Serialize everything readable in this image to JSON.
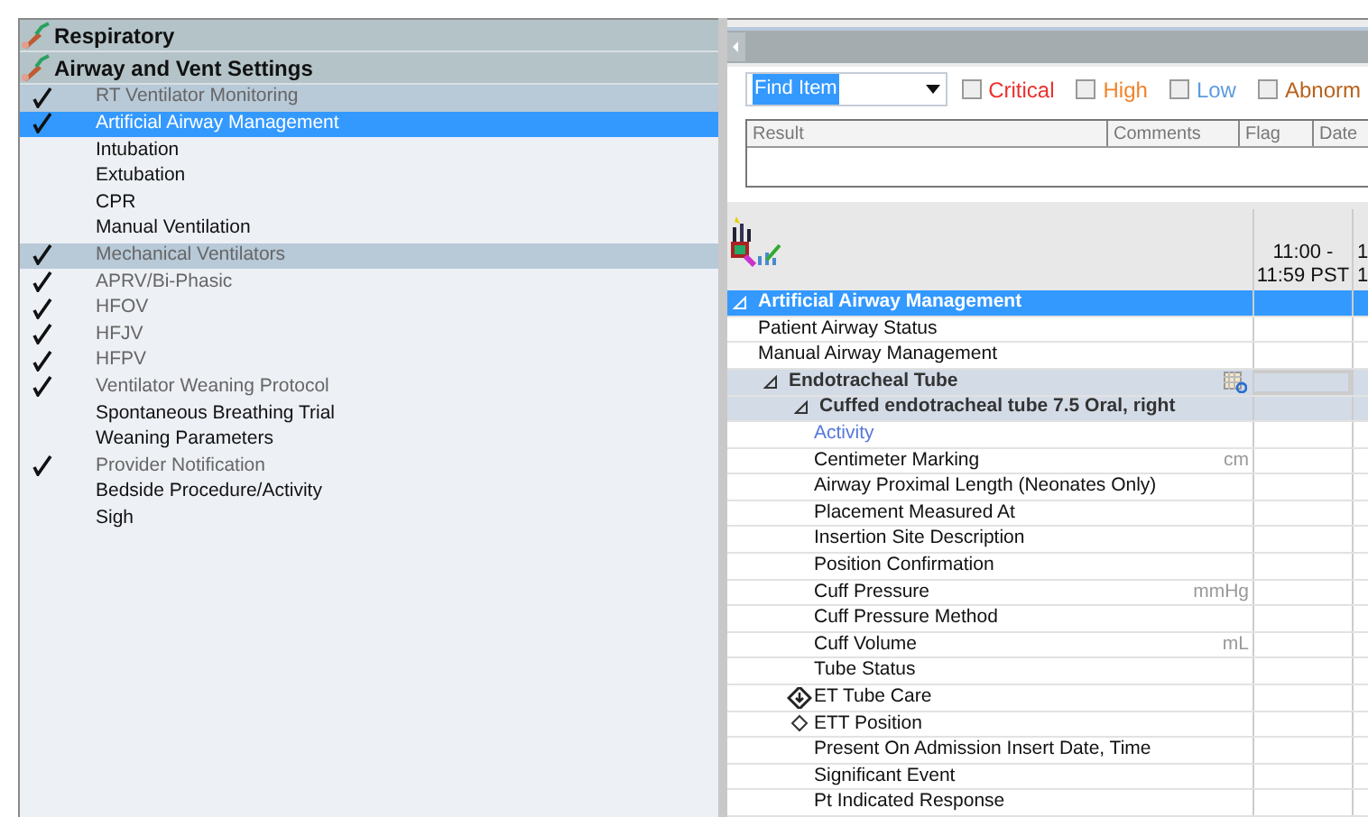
{
  "navigator": {
    "sections": [
      {
        "title": "Respiratory"
      },
      {
        "title": "Airway and Vent Settings"
      }
    ],
    "items": [
      {
        "label": "RT Ventilator Monitoring",
        "kind": "section",
        "checked": true,
        "selected": false
      },
      {
        "label": "Artificial Airway Management",
        "kind": "item",
        "checked": true,
        "selected": true
      },
      {
        "label": "Intubation",
        "kind": "item",
        "checked": false,
        "selected": false
      },
      {
        "label": "Extubation",
        "kind": "item",
        "checked": false,
        "selected": false
      },
      {
        "label": "CPR",
        "kind": "item",
        "checked": false,
        "selected": false
      },
      {
        "label": "Manual Ventilation",
        "kind": "item",
        "checked": false,
        "selected": false
      },
      {
        "label": "Mechanical Ventilators",
        "kind": "section",
        "checked": true,
        "selected": false
      },
      {
        "label": "APRV/Bi-Phasic",
        "kind": "item",
        "checked": true,
        "selected": false
      },
      {
        "label": "HFOV",
        "kind": "item",
        "checked": true,
        "selected": false
      },
      {
        "label": "HFJV",
        "kind": "item",
        "checked": true,
        "selected": false
      },
      {
        "label": "HFPV",
        "kind": "item",
        "checked": true,
        "selected": false
      },
      {
        "label": "Ventilator Weaning Protocol",
        "kind": "item",
        "checked": true,
        "selected": false
      },
      {
        "label": "Spontaneous Breathing Trial",
        "kind": "item",
        "checked": false,
        "selected": false
      },
      {
        "label": "Weaning Parameters",
        "kind": "item",
        "checked": false,
        "selected": false
      },
      {
        "label": "Provider Notification",
        "kind": "item",
        "checked": true,
        "selected": false
      },
      {
        "label": "Bedside Procedure/Activity",
        "kind": "item",
        "checked": false,
        "selected": false
      },
      {
        "label": "Sigh",
        "kind": "item",
        "checked": false,
        "selected": false
      }
    ]
  },
  "filter": {
    "find": {
      "value": "Find Item"
    },
    "flags": [
      {
        "label": "Critical",
        "checked": false,
        "color": "#e8322f"
      },
      {
        "label": "High",
        "checked": false,
        "color": "#f0832a"
      },
      {
        "label": "Low",
        "checked": false,
        "color": "#5b9be0"
      },
      {
        "label": "Abnorm",
        "checked": false,
        "color": "#b8621c"
      }
    ]
  },
  "results_table": {
    "columns": [
      "Result",
      "Comments",
      "Flag",
      "Date"
    ]
  },
  "flowsheet": {
    "columns": [
      {
        "line_1": "11:00 -",
        "line_2": "11:59 PST"
      },
      {
        "line_1": "1",
        "line_2": "1"
      }
    ],
    "rows": [
      {
        "label": "Artificial Airway Management",
        "kind": "header",
        "selected": true,
        "expanded": true,
        "children": [
          {
            "label": "Patient Airway Status",
            "kind": "field"
          },
          {
            "label": "Manual Airway Management",
            "kind": "field"
          },
          {
            "label": "Endotracheal Tube",
            "kind": "group",
            "expanded": true,
            "focused": true,
            "children": [
              {
                "label": "Cuffed endotracheal tube 7.5 Oral, right",
                "kind": "group",
                "expanded": true,
                "children": [
                  {
                    "label": "Activity",
                    "kind": "link"
                  },
                  {
                    "label": "Centimeter Marking",
                    "kind": "field",
                    "unit": "cm"
                  },
                  {
                    "label": "Airway Proximal Length (Neonates Only)",
                    "kind": "field"
                  },
                  {
                    "label": "Placement Measured At",
                    "kind": "field"
                  },
                  {
                    "label": "Insertion Site Description",
                    "kind": "field"
                  },
                  {
                    "label": "Position Confirmation",
                    "kind": "field"
                  },
                  {
                    "label": "Cuff Pressure",
                    "kind": "field",
                    "unit": "mmHg"
                  },
                  {
                    "label": "Cuff Pressure Method",
                    "kind": "field"
                  },
                  {
                    "label": "Cuff Volume",
                    "kind": "field",
                    "unit": "mL"
                  },
                  {
                    "label": "Tube Status",
                    "kind": "field"
                  },
                  {
                    "label": "ET Tube Care",
                    "kind": "form"
                  },
                  {
                    "label": "ETT Position",
                    "kind": "subform"
                  },
                  {
                    "label": "Present On Admission Insert Date, Time",
                    "kind": "field"
                  },
                  {
                    "label": "Significant Event",
                    "kind": "field"
                  },
                  {
                    "label": "Pt Indicated Response",
                    "kind": "field"
                  }
                ]
              }
            ]
          }
        ]
      }
    ]
  }
}
